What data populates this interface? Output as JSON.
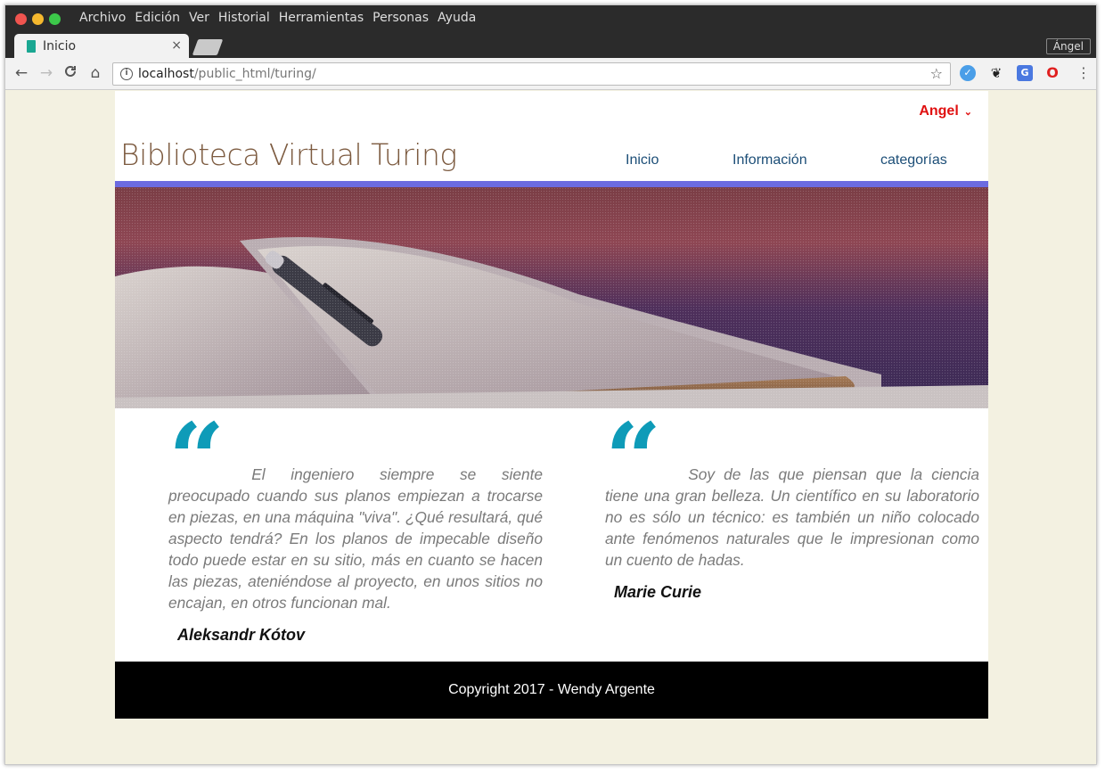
{
  "browser": {
    "menu": [
      "Archivo",
      "Edición",
      "Ver",
      "Historial",
      "Herramientas",
      "Personas",
      "Ayuda"
    ],
    "tab_title": "Inicio",
    "tab_close": "×",
    "profile_label": "Ángel",
    "url_host": "localhost",
    "url_path": "/public_html/turing/",
    "icons": {
      "back": "←",
      "forward": "→",
      "reload": "C",
      "home": "⌂",
      "star": "☆",
      "menu": "⋮"
    }
  },
  "header": {
    "user_name": "Angel",
    "chevron": "⌄",
    "site_title": "Biblioteca Virtual Turing",
    "nav": [
      "Inicio",
      "Información",
      "categorías"
    ]
  },
  "colors": {
    "accent_bar": "#6c6be0",
    "quote_mark": "#0e9bb8",
    "user_name": "#e01010",
    "nav_link": "#1c4e77",
    "title": "#7c5a3f"
  },
  "quotes": [
    {
      "mark": "“",
      "text": "El ingeniero siempre se siente preocupado cuando sus planos empiezan a trocarse en piezas, en una máquina \"viva\". ¿Qué resultará, qué aspecto tendrá? En los planos de impecable diseño todo puede estar en su sitio, más en cuanto se hacen las piezas, ateniéndose al proyecto, en unos sitios no encajan, en otros funcionan mal.",
      "author": "Aleksandr Kótov"
    },
    {
      "mark": "“",
      "text": "Soy de las que piensan que la ciencia tiene una gran belleza. Un científico en su laboratorio no es sólo un técnico: es también un niño colocado ante fenómenos naturales que le impresionan como un cuento de hadas.",
      "author": "Marie Curie"
    }
  ],
  "footer": {
    "copyright": "Copyright 2017 - Wendy Argente"
  }
}
